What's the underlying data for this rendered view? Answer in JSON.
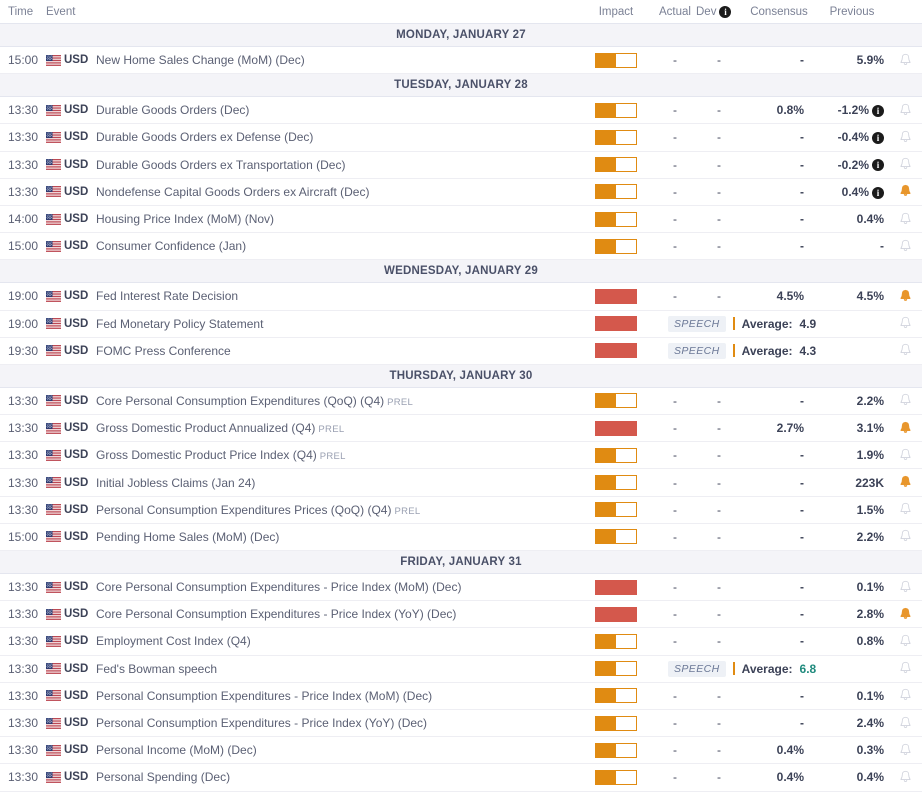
{
  "header": {
    "time": "Time",
    "event": "Event",
    "impact": "Impact",
    "actual": "Actual",
    "dev": "Dev",
    "dev_info_icon": "i",
    "consensus": "Consensus",
    "previous": "Previous"
  },
  "colors": {
    "impact_medium": "#e08b12",
    "impact_high": "#d4584c",
    "bell_active": "#e8962c",
    "bell_inactive": "#c9ccd7",
    "day_header_bg": "#f4f4f8",
    "text": "#3c4257",
    "muted": "#7b8195",
    "teal_value": "#1f8a7d"
  },
  "labels": {
    "speech_badge": "SPEECH",
    "average": "Average:",
    "dash": "-",
    "prel": "PREL",
    "currency": "USD",
    "flag_icon": "us-flag-icon",
    "bell_icon": "bell-icon"
  },
  "days": [
    {
      "title": "MONDAY, JANUARY 27",
      "events": [
        {
          "time": "15:00",
          "currency": "USD",
          "name": "New Home Sales Change (MoM) (Dec)",
          "prel": "",
          "impact": "medium",
          "actual": "-",
          "dev": "-",
          "consensus": "-",
          "previous": "5.9%",
          "previous_info": false,
          "alert": false,
          "type": "data"
        }
      ]
    },
    {
      "title": "TUESDAY, JANUARY 28",
      "events": [
        {
          "time": "13:30",
          "currency": "USD",
          "name": "Durable Goods Orders (Dec)",
          "prel": "",
          "impact": "medium",
          "actual": "-",
          "dev": "-",
          "consensus": "0.8%",
          "previous": "-1.2%",
          "previous_info": true,
          "alert": false,
          "type": "data"
        },
        {
          "time": "13:30",
          "currency": "USD",
          "name": "Durable Goods Orders ex Defense (Dec)",
          "prel": "",
          "impact": "medium",
          "actual": "-",
          "dev": "-",
          "consensus": "-",
          "previous": "-0.4%",
          "previous_info": true,
          "alert": false,
          "type": "data"
        },
        {
          "time": "13:30",
          "currency": "USD",
          "name": "Durable Goods Orders ex Transportation (Dec)",
          "prel": "",
          "impact": "medium",
          "actual": "-",
          "dev": "-",
          "consensus": "-",
          "previous": "-0.2%",
          "previous_info": true,
          "alert": false,
          "type": "data"
        },
        {
          "time": "13:30",
          "currency": "USD",
          "name": "Nondefense Capital Goods Orders ex Aircraft (Dec)",
          "prel": "",
          "impact": "medium",
          "actual": "-",
          "dev": "-",
          "consensus": "-",
          "previous": "0.4%",
          "previous_info": true,
          "alert": true,
          "type": "data"
        },
        {
          "time": "14:00",
          "currency": "USD",
          "name": "Housing Price Index (MoM) (Nov)",
          "prel": "",
          "impact": "medium",
          "actual": "-",
          "dev": "-",
          "consensus": "-",
          "previous": "0.4%",
          "previous_info": false,
          "alert": false,
          "type": "data"
        },
        {
          "time": "15:00",
          "currency": "USD",
          "name": "Consumer Confidence (Jan)",
          "prel": "",
          "impact": "medium",
          "actual": "-",
          "dev": "-",
          "consensus": "-",
          "previous": "-",
          "previous_info": false,
          "alert": false,
          "type": "data"
        }
      ]
    },
    {
      "title": "WEDNESDAY, JANUARY 29",
      "events": [
        {
          "time": "19:00",
          "currency": "USD",
          "name": "Fed Interest Rate Decision",
          "prel": "",
          "impact": "high",
          "actual": "-",
          "dev": "-",
          "consensus": "4.5%",
          "previous": "4.5%",
          "previous_info": false,
          "alert": true,
          "type": "data"
        },
        {
          "time": "19:00",
          "currency": "USD",
          "name": "Fed Monetary Policy Statement",
          "prel": "",
          "impact": "high",
          "alert": false,
          "type": "speech",
          "speech_label": "SPEECH",
          "average_label": "Average:",
          "average_value": "4.9",
          "average_teal": false
        },
        {
          "time": "19:30",
          "currency": "USD",
          "name": "FOMC Press Conference",
          "prel": "",
          "impact": "high",
          "alert": false,
          "type": "speech",
          "speech_label": "SPEECH",
          "average_label": "Average:",
          "average_value": "4.3",
          "average_teal": false
        }
      ]
    },
    {
      "title": "THURSDAY, JANUARY 30",
      "events": [
        {
          "time": "13:30",
          "currency": "USD",
          "name": "Core Personal Consumption Expenditures (QoQ) (Q4)",
          "prel": "PREL",
          "impact": "medium",
          "actual": "-",
          "dev": "-",
          "consensus": "-",
          "previous": "2.2%",
          "previous_info": false,
          "alert": false,
          "type": "data"
        },
        {
          "time": "13:30",
          "currency": "USD",
          "name": "Gross Domestic Product Annualized (Q4)",
          "prel": "PREL",
          "impact": "high",
          "actual": "-",
          "dev": "-",
          "consensus": "2.7%",
          "previous": "3.1%",
          "previous_info": false,
          "alert": true,
          "type": "data"
        },
        {
          "time": "13:30",
          "currency": "USD",
          "name": "Gross Domestic Product Price Index (Q4)",
          "prel": "PREL",
          "impact": "medium",
          "actual": "-",
          "dev": "-",
          "consensus": "-",
          "previous": "1.9%",
          "previous_info": false,
          "alert": false,
          "type": "data"
        },
        {
          "time": "13:30",
          "currency": "USD",
          "name": "Initial Jobless Claims (Jan 24)",
          "prel": "",
          "impact": "medium",
          "actual": "-",
          "dev": "-",
          "consensus": "-",
          "previous": "223K",
          "previous_info": false,
          "alert": true,
          "type": "data"
        },
        {
          "time": "13:30",
          "currency": "USD",
          "name": "Personal Consumption Expenditures Prices (QoQ) (Q4)",
          "prel": "PREL",
          "impact": "medium",
          "actual": "-",
          "dev": "-",
          "consensus": "-",
          "previous": "1.5%",
          "previous_info": false,
          "alert": false,
          "type": "data"
        },
        {
          "time": "15:00",
          "currency": "USD",
          "name": "Pending Home Sales (MoM) (Dec)",
          "prel": "",
          "impact": "medium",
          "actual": "-",
          "dev": "-",
          "consensus": "-",
          "previous": "2.2%",
          "previous_info": false,
          "alert": false,
          "type": "data"
        }
      ]
    },
    {
      "title": "FRIDAY, JANUARY 31",
      "events": [
        {
          "time": "13:30",
          "currency": "USD",
          "name": "Core Personal Consumption Expenditures - Price Index (MoM) (Dec)",
          "prel": "",
          "impact": "high",
          "actual": "-",
          "dev": "-",
          "consensus": "-",
          "previous": "0.1%",
          "previous_info": false,
          "alert": false,
          "type": "data"
        },
        {
          "time": "13:30",
          "currency": "USD",
          "name": "Core Personal Consumption Expenditures - Price Index (YoY) (Dec)",
          "prel": "",
          "impact": "high",
          "actual": "-",
          "dev": "-",
          "consensus": "-",
          "previous": "2.8%",
          "previous_info": false,
          "alert": true,
          "type": "data"
        },
        {
          "time": "13:30",
          "currency": "USD",
          "name": "Employment Cost Index (Q4)",
          "prel": "",
          "impact": "medium",
          "actual": "-",
          "dev": "-",
          "consensus": "-",
          "previous": "0.8%",
          "previous_info": false,
          "alert": false,
          "type": "data"
        },
        {
          "time": "13:30",
          "currency": "USD",
          "name": "Fed's Bowman speech",
          "prel": "",
          "impact": "medium",
          "alert": false,
          "type": "speech",
          "speech_label": "SPEECH",
          "average_label": "Average:",
          "average_value": "6.8",
          "average_teal": true
        },
        {
          "time": "13:30",
          "currency": "USD",
          "name": "Personal Consumption Expenditures - Price Index (MoM) (Dec)",
          "prel": "",
          "impact": "medium",
          "actual": "-",
          "dev": "-",
          "consensus": "-",
          "previous": "0.1%",
          "previous_info": false,
          "alert": false,
          "type": "data"
        },
        {
          "time": "13:30",
          "currency": "USD",
          "name": "Personal Consumption Expenditures - Price Index (YoY) (Dec)",
          "prel": "",
          "impact": "medium",
          "actual": "-",
          "dev": "-",
          "consensus": "-",
          "previous": "2.4%",
          "previous_info": false,
          "alert": false,
          "type": "data"
        },
        {
          "time": "13:30",
          "currency": "USD",
          "name": "Personal Income (MoM) (Dec)",
          "prel": "",
          "impact": "medium",
          "actual": "-",
          "dev": "-",
          "consensus": "0.4%",
          "previous": "0.3%",
          "previous_info": false,
          "alert": false,
          "type": "data"
        },
        {
          "time": "13:30",
          "currency": "USD",
          "name": "Personal Spending (Dec)",
          "prel": "",
          "impact": "medium",
          "actual": "-",
          "dev": "-",
          "consensus": "0.4%",
          "previous": "0.4%",
          "previous_info": false,
          "alert": false,
          "type": "data"
        }
      ]
    }
  ]
}
